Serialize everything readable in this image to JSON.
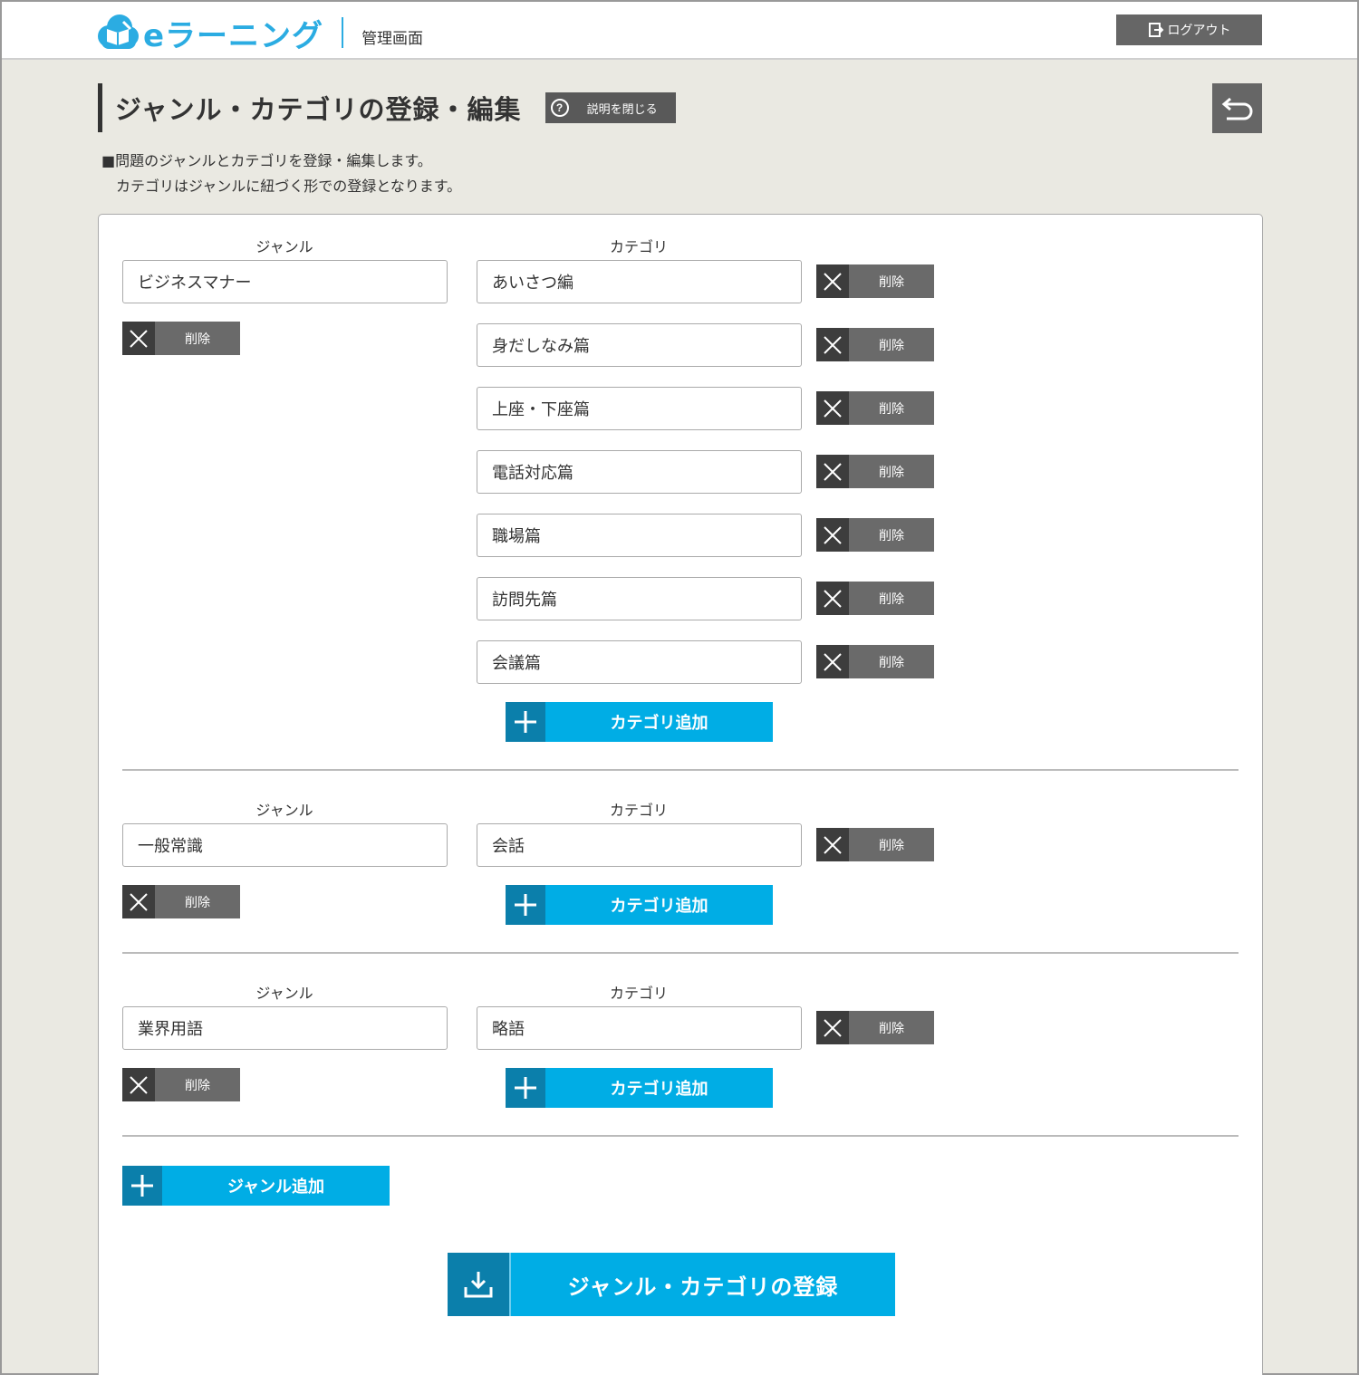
{
  "header": {
    "logo_text": "eラーニング",
    "logo_sub": "管理画面",
    "logout_label": "ログアウト"
  },
  "page": {
    "title": "ジャンル・カテゴリの登録・編集",
    "help_label": "説明を閉じる",
    "desc_line1": "■問題のジャンルとカテゴリを登録・編集します。",
    "desc_line2": "カテゴリはジャンルに紐づく形での登録となります。"
  },
  "labels": {
    "genre": "ジャンル",
    "category": "カテゴリ",
    "delete": "削除",
    "add_category": "カテゴリ追加",
    "add_genre": "ジャンル追加",
    "submit": "ジャンル・カテゴリの登録"
  },
  "genres": [
    {
      "name": "ビジネスマナー",
      "categories": [
        "あいさつ編",
        "身だしなみ篇",
        "上座・下座篇",
        "電話対応篇",
        "職場篇",
        "訪問先篇",
        "会議篇"
      ]
    },
    {
      "name": "一般常識",
      "categories": [
        "会話"
      ]
    },
    {
      "name": "業界用語",
      "categories": [
        "略語"
      ]
    }
  ],
  "colors": {
    "accent": "#00ade5",
    "accent_dark": "#0b7fab",
    "button_gray": "#6a6a6a",
    "background": "#eae9e2"
  }
}
